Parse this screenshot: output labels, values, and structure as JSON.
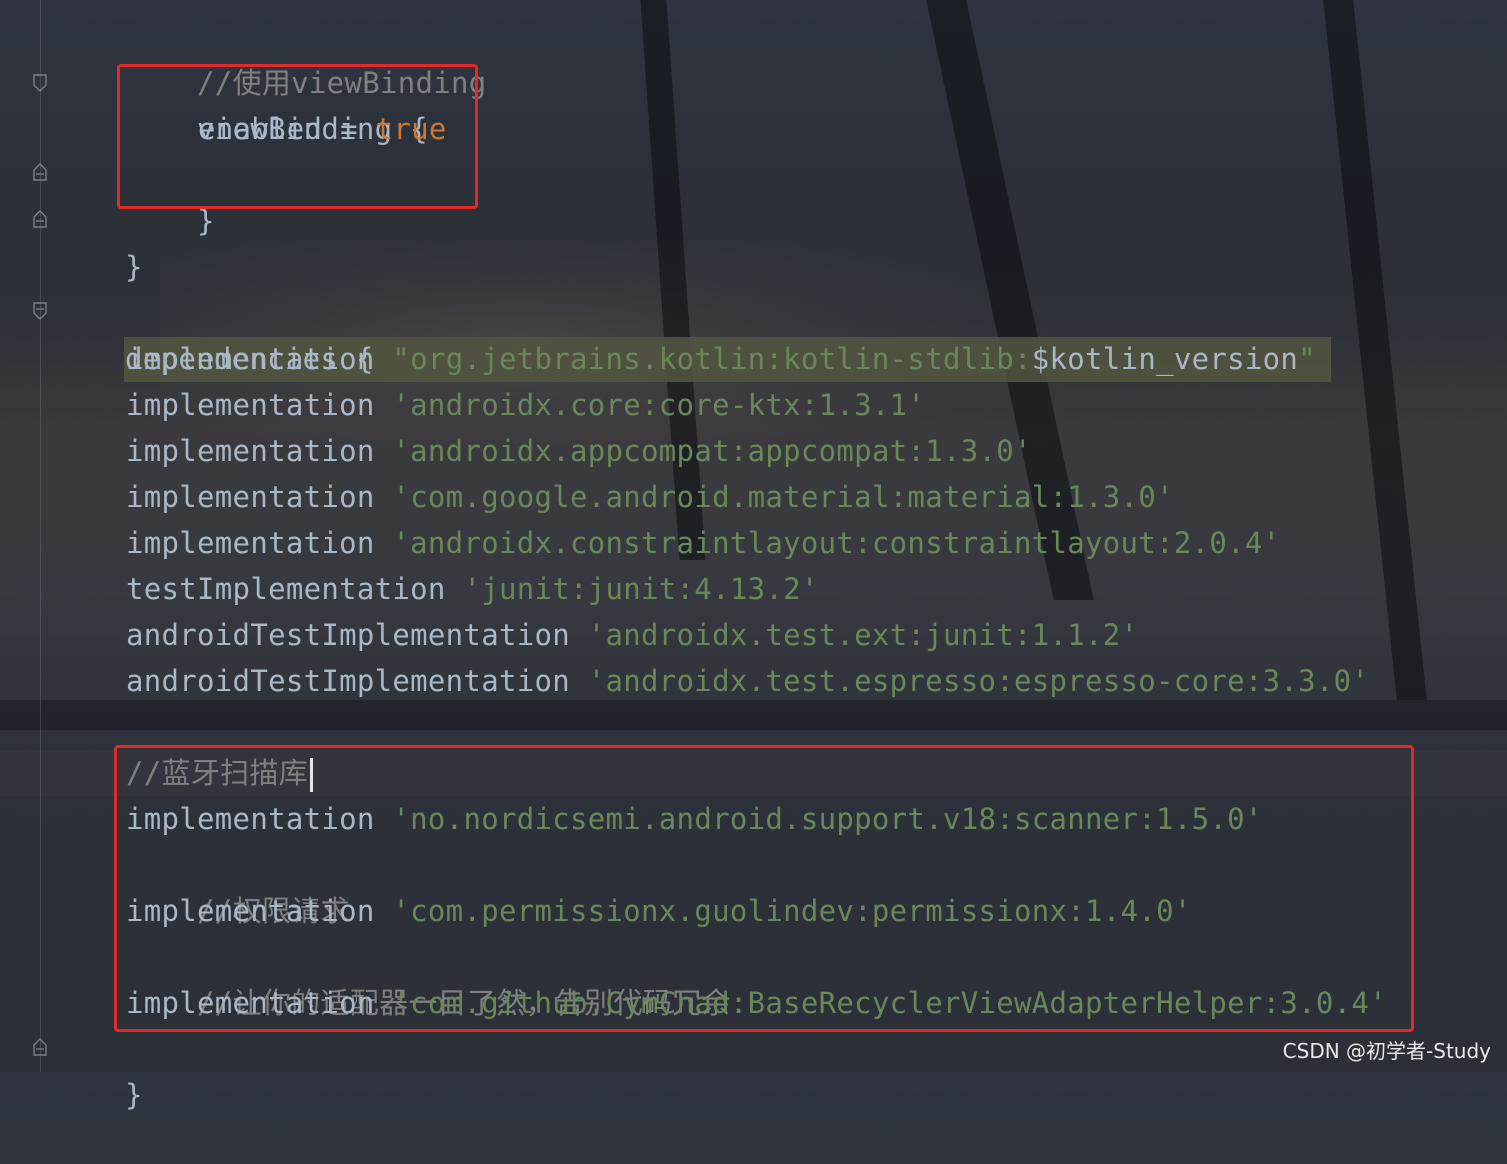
{
  "editor": {
    "lines": {
      "comment_viewbinding": "//使用viewBinding",
      "viewbinding_open": "viewBinding {",
      "enabled_key": "enabled = ",
      "enabled_value": "true",
      "close_inner": "}",
      "close_android": "}",
      "dependencies_open": "dependencies {",
      "deps": [
        {
          "config": "implementation ",
          "quote": "\"",
          "artifact": "org.jetbrains.kotlin:kotlin-stdlib:",
          "var": "$kotlin_version",
          "end": "\""
        },
        {
          "config": "implementation ",
          "artifact": "'androidx.core:core-ktx:1.3.1'"
        },
        {
          "config": "implementation ",
          "artifact": "'androidx.appcompat:appcompat:1.3.0'"
        },
        {
          "config": "implementation ",
          "artifact": "'com.google.android.material:material:1.3.0'"
        },
        {
          "config": "implementation ",
          "artifact": "'androidx.constraintlayout:constraintlayout:2.0.4'"
        },
        {
          "config": "testImplementation ",
          "artifact": "'junit:junit:4.13.2'"
        },
        {
          "config": "androidTestImplementation ",
          "artifact": "'androidx.test.ext:junit:1.1.2'"
        },
        {
          "config": "androidTestImplementation ",
          "artifact": "'androidx.test.espresso:espresso-core:3.3.0'"
        }
      ],
      "comment_bluetooth": "//蓝牙扫描库",
      "dep_scanner": {
        "config": "implementation ",
        "artifact": "'no.nordicsemi.android.support.v18:scanner:1.5.0'"
      },
      "comment_permission": "//权限请求",
      "dep_permission": {
        "config": "implementation ",
        "artifact": "'com.permissionx.guolindev:permissionx:1.4.0'"
      },
      "comment_adapter": "//让你的适配器一目了然，告别代码冗余",
      "dep_adapter": {
        "config": "implementation ",
        "artifact": "'com.github.CymChad:BaseRecyclerViewAdapterHelper:3.0.4'"
      },
      "close_dependencies": "}"
    },
    "colors": {
      "text": "#a9b7c6",
      "string": "#6a8759",
      "keyword_bool": "#cc7832",
      "comment": "#808080",
      "annotation_box": "#e02a2a"
    }
  },
  "watermark": "CSDN @初学者-Study"
}
